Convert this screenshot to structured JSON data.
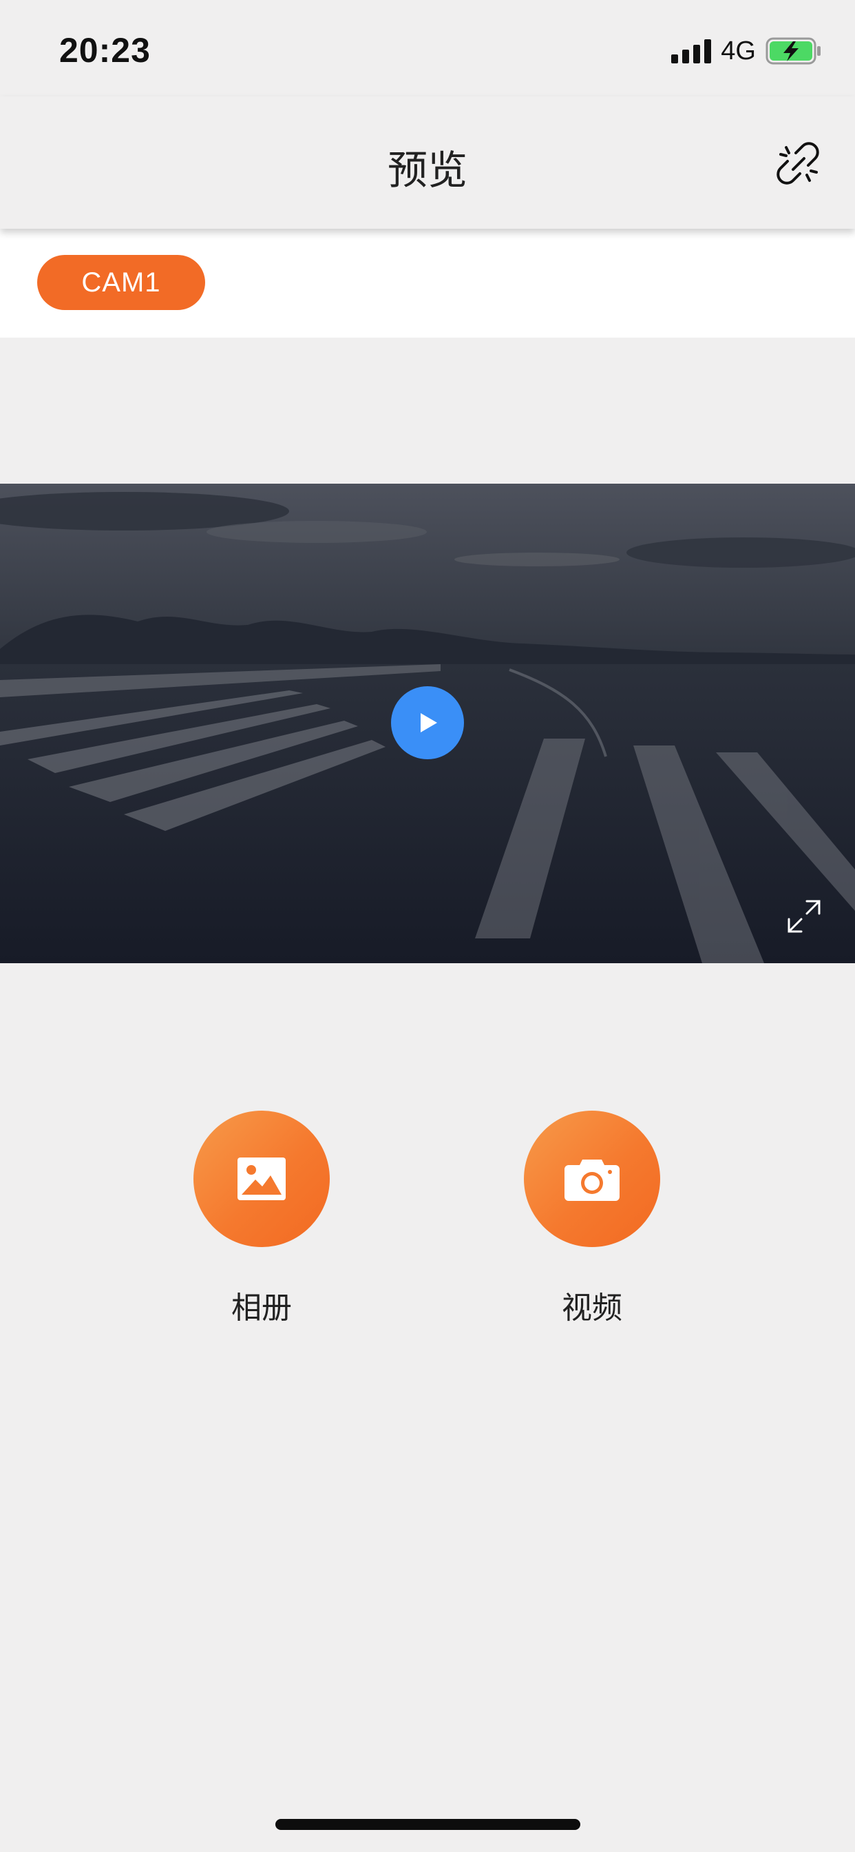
{
  "status_bar": {
    "time": "20:23",
    "network": "4G",
    "battery_state": "charging",
    "battery_color": "#4cd964"
  },
  "header": {
    "title": "预览",
    "link_icon": "broken-link-icon"
  },
  "camera_tabs": [
    {
      "label": "CAM1",
      "selected": true
    }
  ],
  "player": {
    "play_icon": "play-icon",
    "fullscreen_icon": "expand-icon",
    "play_button_color": "#3a8ff7"
  },
  "actions": {
    "album": {
      "label": "相册",
      "icon": "image-icon"
    },
    "video": {
      "label": "视频",
      "icon": "camera-icon"
    }
  },
  "colors": {
    "accent": "#f26b26",
    "background": "#f0efef"
  }
}
